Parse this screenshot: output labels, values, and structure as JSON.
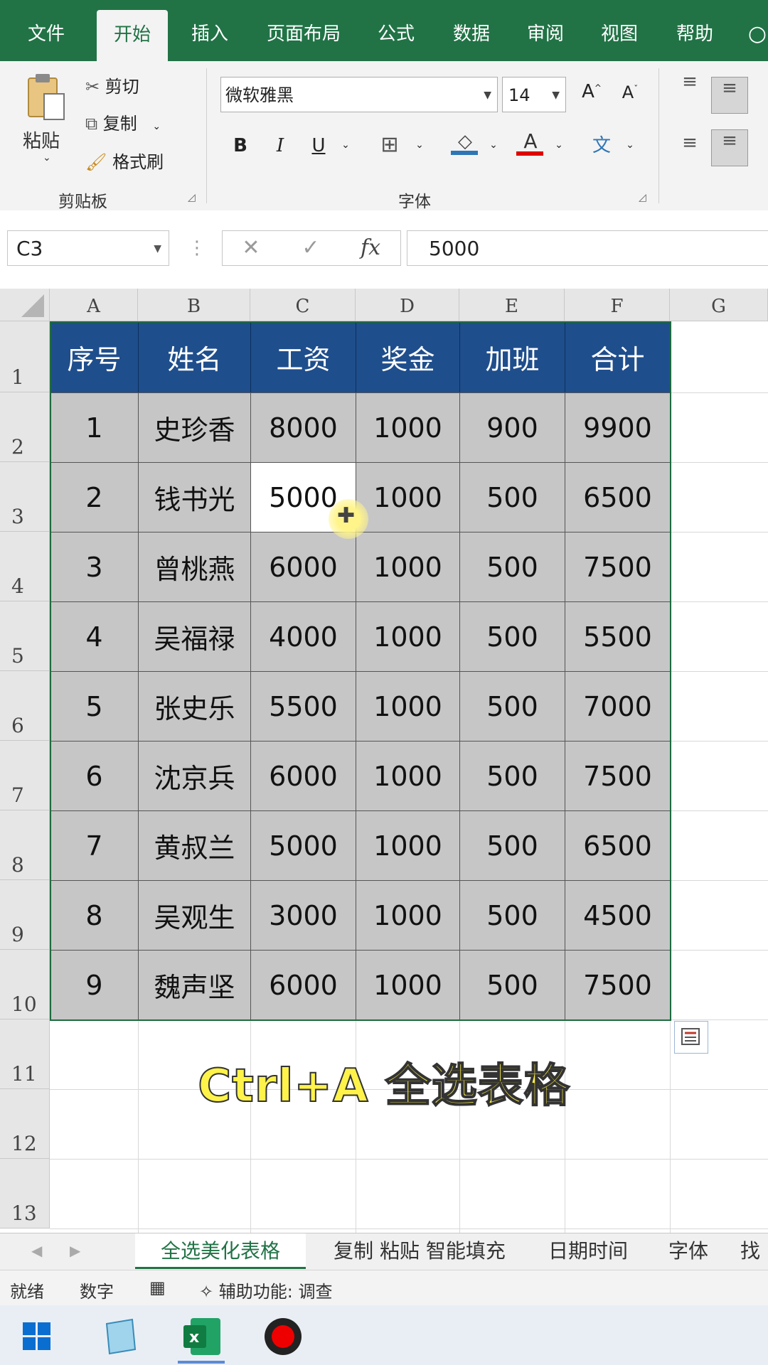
{
  "ribbon_tabs": [
    "文件",
    "开始",
    "插入",
    "页面布局",
    "公式",
    "数据",
    "审阅",
    "视图",
    "帮助"
  ],
  "active_tab": "开始",
  "clipboard": {
    "paste": "粘贴",
    "cut": "剪切",
    "copy": "复制",
    "format_painter": "格式刷",
    "group_label": "剪贴板"
  },
  "font": {
    "name": "微软雅黑",
    "size": "14",
    "group_label": "字体",
    "bold": "B",
    "italic": "I",
    "underline": "U"
  },
  "formula_bar": {
    "name_box": "C3",
    "cancel": "✕",
    "enter": "✓",
    "fx": "fx",
    "value": "5000"
  },
  "columns": [
    "A",
    "B",
    "C",
    "D",
    "E",
    "F",
    "G"
  ],
  "rows": [
    "1",
    "2",
    "3",
    "4",
    "5",
    "6",
    "7",
    "8",
    "9",
    "10",
    "11",
    "12",
    "13"
  ],
  "table": {
    "headers": [
      "序号",
      "姓名",
      "工资",
      "奖金",
      "加班",
      "合计"
    ],
    "rows": [
      [
        "1",
        "史珍香",
        "8000",
        "1000",
        "900",
        "9900"
      ],
      [
        "2",
        "钱书光",
        "5000",
        "1000",
        "500",
        "6500"
      ],
      [
        "3",
        "曾桃燕",
        "6000",
        "1000",
        "500",
        "7500"
      ],
      [
        "4",
        "吴福禄",
        "4000",
        "1000",
        "500",
        "5500"
      ],
      [
        "5",
        "张史乐",
        "5500",
        "1000",
        "500",
        "7000"
      ],
      [
        "6",
        "沈京兵",
        "6000",
        "1000",
        "500",
        "7500"
      ],
      [
        "7",
        "黄叔兰",
        "5000",
        "1000",
        "500",
        "6500"
      ],
      [
        "8",
        "吴观生",
        "3000",
        "1000",
        "500",
        "4500"
      ],
      [
        "9",
        "魏声坚",
        "6000",
        "1000",
        "500",
        "7500"
      ]
    ]
  },
  "caption": "Ctrl+A  全选表格",
  "sheet_tabs": [
    "全选美化表格",
    "复制 粘贴 智能填充",
    "日期时间",
    "字体",
    "找"
  ],
  "status": {
    "ready": "就绪",
    "mode": "数字",
    "accessibility": "辅助功能: 调查"
  },
  "colors": {
    "excel_green": "#217346",
    "header_blue": "#1f4e8c",
    "cell_gray": "#c6c6c6",
    "caption_yellow": "#fff34a"
  }
}
